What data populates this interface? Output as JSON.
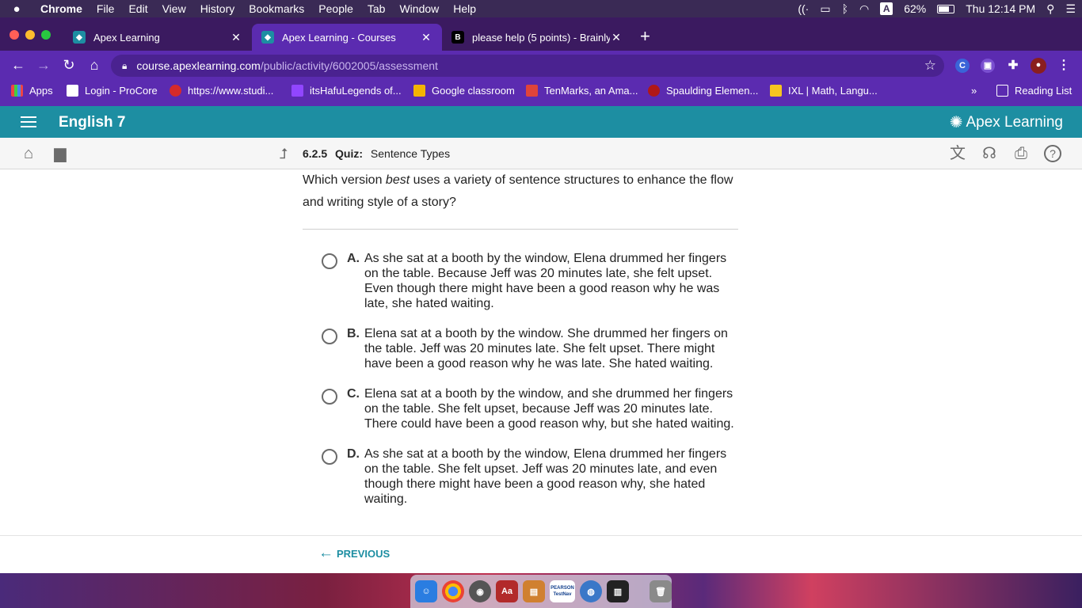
{
  "menubar": {
    "app": "Chrome",
    "items": [
      "File",
      "Edit",
      "View",
      "History",
      "Bookmarks",
      "People",
      "Tab",
      "Window",
      "Help"
    ],
    "battery": "62%",
    "clock": "Thu 12:14 PM",
    "input_source": "A"
  },
  "tabs": [
    {
      "title": "Apex Learning"
    },
    {
      "title": "Apex Learning - Courses"
    },
    {
      "title": "please help (5 points) - Brainly"
    }
  ],
  "address": {
    "host": "course.apexlearning.com",
    "path": "/public/activity/6002005/assessment"
  },
  "bookmarks": [
    "Apps",
    "Login - ProCore",
    "https://www.studi...",
    "itsHafuLegends of...",
    "Google classroom",
    "TenMarks, an Ama...",
    "Spaulding Elemen...",
    "IXL | Math, Langu..."
  ],
  "reading_list": "Reading List",
  "course": {
    "title": "English 7",
    "brand": "Apex Learning"
  },
  "breadcrumb": {
    "number": "6.2.5",
    "type": "Quiz:",
    "name": "Sentence Types"
  },
  "question": {
    "before": "Which version ",
    "emphasis": "best",
    "after": " uses a variety of sentence structures to enhance the flow and writing style of a story?"
  },
  "options": [
    {
      "letter": "A.",
      "text": "As she sat at a booth by the window, Elena drummed her fingers on the table. Because Jeff was 20 minutes late, she felt upset. Even though there might have been a good reason why he was late, she hated waiting."
    },
    {
      "letter": "B.",
      "text": "Elena sat at a booth by the window. She drummed her fingers on the table. Jeff was 20 minutes late. She felt upset. There might have been a good reason why he was late. She hated waiting."
    },
    {
      "letter": "C.",
      "text": "Elena sat at a booth by the window, and she drummed her fingers on the table. She felt upset, because Jeff was 20 minutes late. There could have been a good reason why, but she hated waiting."
    },
    {
      "letter": "D.",
      "text": "As she sat at a booth by the window, Elena drummed her fingers on the table. She felt upset. Jeff was 20 minutes late, and even though there might have been a good reason why, she hated waiting."
    }
  ],
  "footer": {
    "previous": "PREVIOUS"
  },
  "dock": {
    "pearson_label": "PEARSON",
    "testnav_label": "TestNav"
  },
  "colors": {
    "apex_teal": "#1d8ea2",
    "browser_purple": "#5b2bb0"
  }
}
